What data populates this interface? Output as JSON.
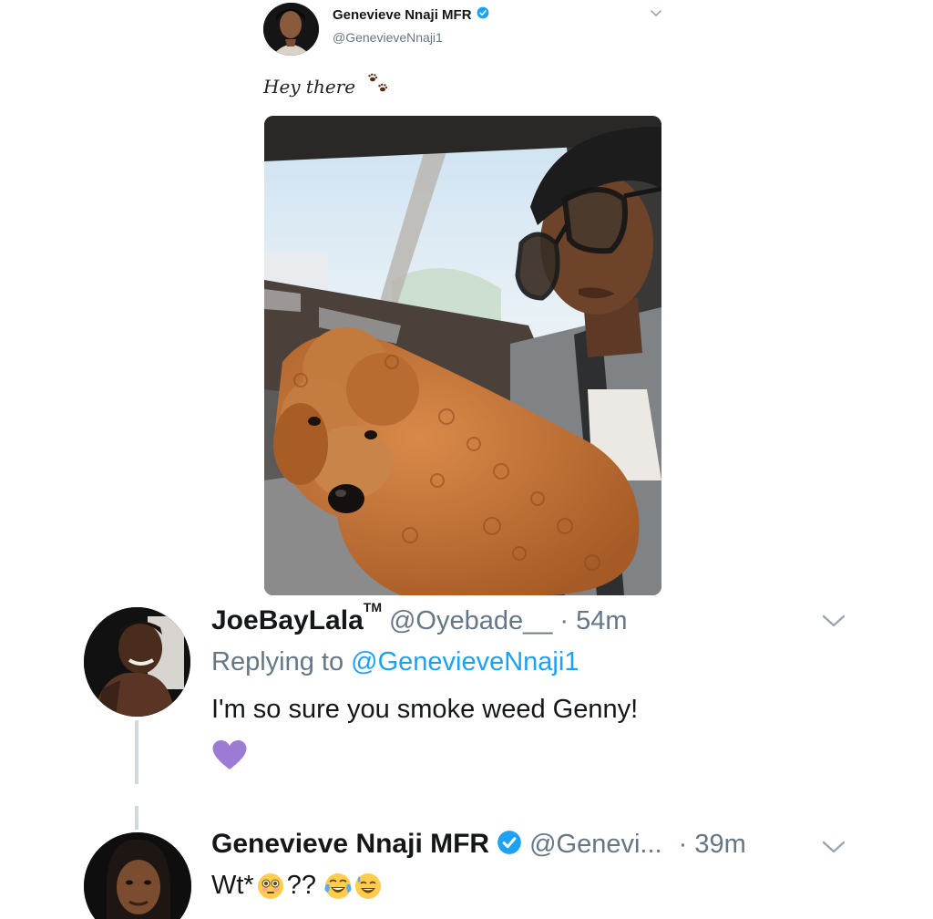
{
  "top_tweet": {
    "author_name": "Genevieve Nnaji MFR",
    "handle": "@GenevieveNnaji1",
    "text": "Hey there",
    "text_emoji_icon": "paw-prints-icon"
  },
  "reply1": {
    "author_name": "JoeBayLala",
    "trademark": "TM",
    "handle": "@Oyebade__",
    "time": "· 54m",
    "replying_prefix": "Replying to",
    "replying_to": "@GenevieveNnaji1",
    "text": "I'm so sure you smoke weed Genny!",
    "like_icon": "purple-heart-icon"
  },
  "reply2": {
    "author_name": "Genevieve Nnaji MFR",
    "handle": "@Genevi...",
    "time": "· 39m",
    "text_prefix": "Wt*",
    "text_mid": "??",
    "emoji_icons": [
      "flushed-face-icon",
      "tears-of-joy-icon",
      "sweat-smile-icon"
    ]
  },
  "colors": {
    "verified_blue": "#1da1f2",
    "link_blue": "#1da1f2",
    "secondary_text": "#657786",
    "heart_purple": "#9b7bd4"
  }
}
